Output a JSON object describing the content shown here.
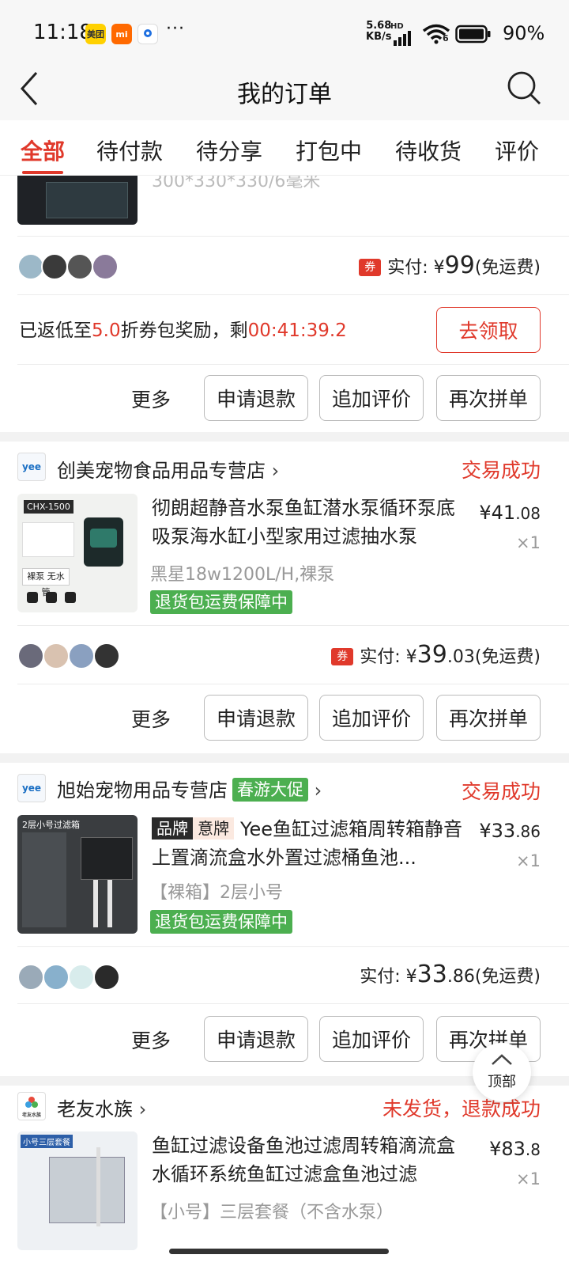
{
  "statusbar": {
    "time": "11:18",
    "app1": "美团",
    "app2": "mi",
    "dots": "···",
    "speed_top": "5.68",
    "speed_bottom": "KB/s",
    "hd": "HD",
    "wifi_label": "6",
    "battery": "90%"
  },
  "nav": {
    "title": "我的订单"
  },
  "tabs": [
    "全部",
    "待付款",
    "待分享",
    "打包中",
    "待收货",
    "评价"
  ],
  "order0": {
    "partial_title": "300*330*330/6毫米",
    "paid_label": "实付:",
    "currency": "¥",
    "paid_int": "99",
    "paid_dec": "",
    "shipping": "(免运费)",
    "coupon": "券",
    "reward_prefix": "已返低至",
    "reward_value": "5.0",
    "reward_mid": "折券包奖励，剩",
    "reward_timer": "00:41:39.2",
    "claim": "去领取",
    "more": "更多",
    "buttons": [
      "申请退款",
      "追加评价",
      "再次拼单"
    ]
  },
  "order1": {
    "shop": "创美宠物食品用品专营店",
    "logo": "yee",
    "status": "交易成功",
    "thumb_label": "CHX-1500",
    "thumb_sub": "裸泵 无水管",
    "title": "彻朗超静音水泵鱼缸潜水泵循环泵底吸泵海水缸小型家用过滤抽水泵",
    "price_int": "¥41",
    "price_dec": ".08",
    "qty": "×1",
    "sku": "黑星18w1200L/H,裸泵",
    "guard": "退货包运费保障中",
    "coupon": "券",
    "paid_label": "实付:",
    "currency": "¥",
    "paid_int": "39",
    "paid_dec": ".03",
    "shipping": "(免运费)",
    "more": "更多",
    "buttons": [
      "申请退款",
      "追加评价",
      "再次拼单"
    ]
  },
  "order2": {
    "shop": "旭始宠物用品专营店",
    "logo": "yee",
    "promo": "春游大促",
    "status": "交易成功",
    "thumb_label": "2层小号过滤箱",
    "badge_a": "品牌",
    "badge_b": "意牌",
    "title": "Yee鱼缸过滤箱周转箱静音上置滴流盒水外置过滤桶鱼池...",
    "price_int": "¥33",
    "price_dec": ".86",
    "qty": "×1",
    "sku": "【裸箱】2层小号",
    "guard": "退货包运费保障中",
    "paid_label": "实付:",
    "currency": "¥",
    "paid_int": "33",
    "paid_dec": ".86",
    "shipping": "(免运费)",
    "more": "更多",
    "buttons": [
      "申请退款",
      "追加评价",
      "再次拼单"
    ]
  },
  "order3": {
    "shop": "老友水族",
    "logo": "老友水族",
    "status": "未发货，退款成功",
    "thumb_label": "小号三层套餐",
    "title": "鱼缸过滤设备鱼池过滤周转箱滴流盒水循环系统鱼缸过滤盒鱼池过滤",
    "price_int": "¥83",
    "price_dec": ".8",
    "qty": "×1",
    "sku": "【小号】三层套餐（不含水泵）"
  },
  "float_top": {
    "label": "顶部"
  },
  "colors": {
    "accent": "#e0392b",
    "guard_green": "#4caf50",
    "divider": "#f2f2f2"
  }
}
